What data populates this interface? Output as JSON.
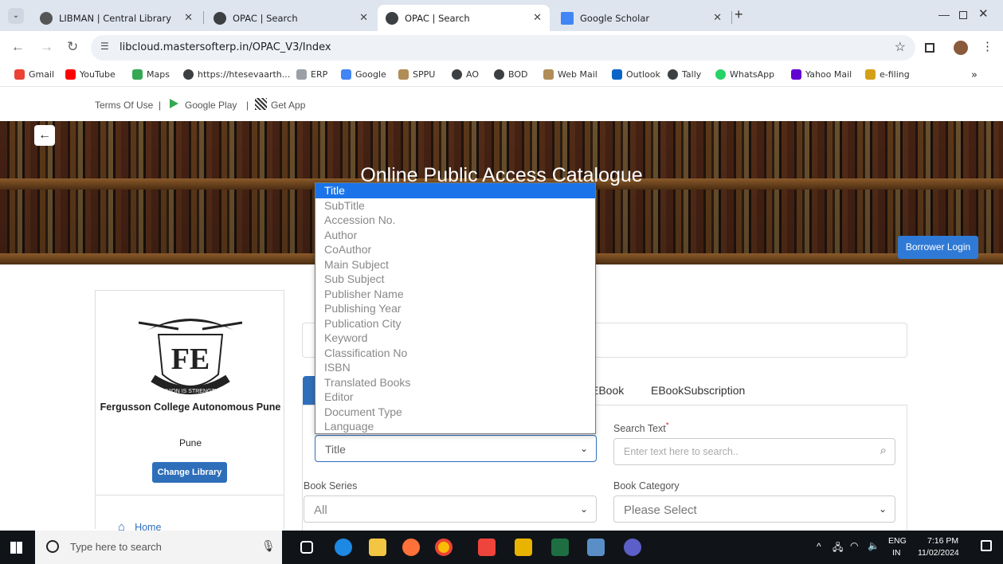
{
  "browser": {
    "tabs": [
      {
        "title": "LIBMAN | Central Library",
        "active": false
      },
      {
        "title": "OPAC | Search",
        "active": false
      },
      {
        "title": "OPAC | Search",
        "active": true
      },
      {
        "title": "Google Scholar",
        "active": false
      }
    ],
    "new_tab": "+",
    "url": "libcloud.mastersofterp.in/OPAC_V3/Index",
    "bookmarks": [
      "Gmail",
      "YouTube",
      "Maps",
      "https://htesevaarth...",
      "ERP",
      "Google",
      "SPPU",
      "AO",
      "BOD",
      "Web Mail",
      "Outlook",
      "Tally",
      "WhatsApp",
      "Yahoo Mail",
      "e-filing"
    ],
    "more": "»"
  },
  "topline": {
    "terms": "Terms Of Use",
    "divider": "|",
    "google_play": "Google Play",
    "get_app": "Get App"
  },
  "banner": {
    "title": "Online Public Access Catalogue",
    "borrower_login": "Borrower Login"
  },
  "sidebar": {
    "college": "Fergusson College Autonomous Pune",
    "city": "Pune",
    "change_library": "Change Library",
    "home": "Home",
    "logo_motto": "UNION IS STRENGTH"
  },
  "tabs": {
    "ebook": "EBook",
    "ebook_subscription": "EBookSubscription"
  },
  "form": {
    "search_by_value": "Title",
    "search_text_label": "Search Text",
    "required_mark": "*",
    "search_text_placeholder": "Enter text here to search..",
    "book_series_label": "Book Series",
    "book_series_value": "All",
    "book_category_label": "Book Category",
    "book_category_value": "Please Select"
  },
  "dropdown": {
    "options": [
      "Title",
      "SubTitle",
      "Accession No.",
      "Author",
      "CoAuthor",
      "Main Subject",
      "Sub Subject",
      "Publisher Name",
      "Publishing Year",
      "Publication City",
      "Keyword",
      "Classification No",
      "ISBN",
      "Translated Books",
      "Editor",
      "Document Type",
      "Language"
    ],
    "selected": "Title"
  },
  "taskbar": {
    "search_placeholder": "Type here to search",
    "lang": "ENG",
    "region": "IN",
    "time": "7:16 PM",
    "date": "11/02/2024"
  }
}
